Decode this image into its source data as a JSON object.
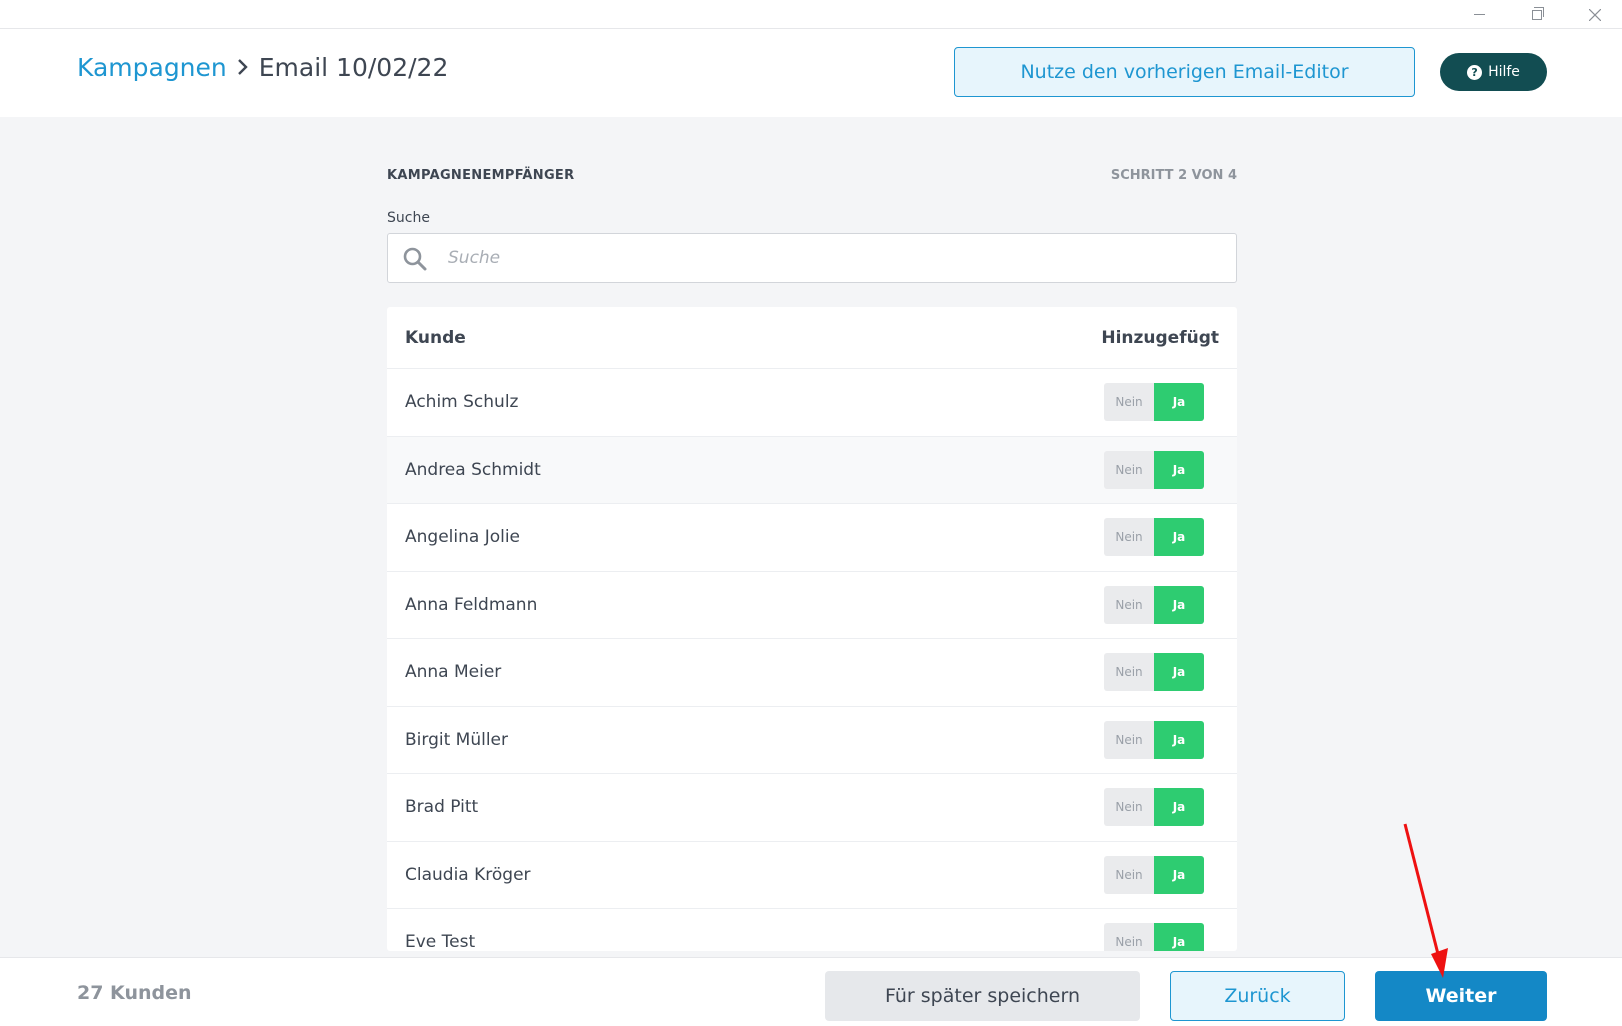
{
  "window": {
    "minimize_icon": "minimize-icon",
    "maximize_icon": "restore-icon",
    "close_icon": "close-icon"
  },
  "header": {
    "breadcrumb_root": "Kampagnen",
    "breadcrumb_current": "Email 10/02/22",
    "legacy_editor_label": "Nutze den vorherigen Email-Editor",
    "help_label": "Hilfe"
  },
  "main": {
    "section_title": "KAMPAGNENEMPFÄNGER",
    "step": "SCHRITT 2 VON 4",
    "search_label": "Suche",
    "search_placeholder": "Suche",
    "table": {
      "col_customer": "Kunde",
      "col_added": "Hinzugefügt",
      "toggle_no": "Nein",
      "toggle_yes": "Ja",
      "rows": [
        {
          "name": "Achim Schulz",
          "added": "Ja"
        },
        {
          "name": "Andrea Schmidt",
          "added": "Ja"
        },
        {
          "name": "Angelina Jolie",
          "added": "Ja"
        },
        {
          "name": "Anna Feldmann",
          "added": "Ja"
        },
        {
          "name": "Anna Meier",
          "added": "Ja"
        },
        {
          "name": "Birgit Müller",
          "added": "Ja"
        },
        {
          "name": "Brad Pitt",
          "added": "Ja"
        },
        {
          "name": "Claudia Kröger",
          "added": "Ja"
        },
        {
          "name": "Eve Test",
          "added": "Ja"
        }
      ]
    }
  },
  "footer": {
    "count": "27 Kunden",
    "save_later": "Für später speichern",
    "back": "Zurück",
    "next": "Weiter"
  },
  "colors": {
    "accent": "#1e96d1",
    "primary_button": "#1488c6",
    "toggle_on": "#2ecc71",
    "help_button": "#124d52",
    "annotation_arrow": "#ee1111"
  }
}
